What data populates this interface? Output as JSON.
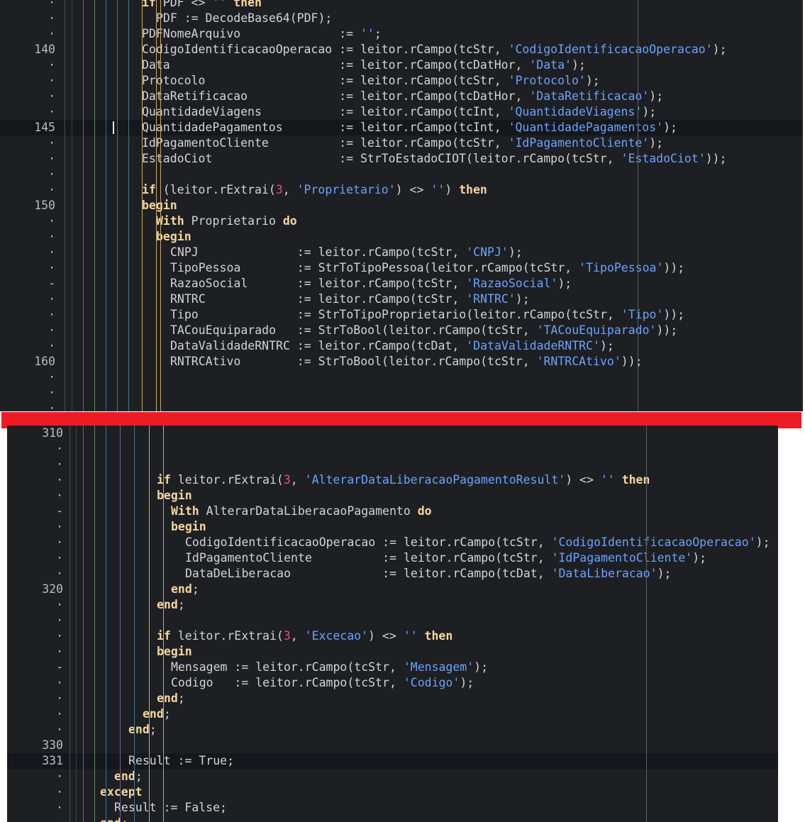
{
  "top_pane": {
    "lines": [
      {
        "gutter": "·",
        "code": [
          [
            "kw",
            "if"
          ],
          [
            "t",
            " PDF <> "
          ],
          [
            "str",
            "''"
          ],
          [
            "t",
            " "
          ],
          [
            "kw",
            "then"
          ]
        ],
        "indent": 0
      },
      {
        "gutter": "·",
        "code": [
          [
            "t",
            "PDF := DecodeBase64(PDF);"
          ]
        ],
        "indent": 1
      },
      {
        "gutter": "·",
        "code": [
          [
            "t",
            "PDFNomeArquivo              := "
          ],
          [
            "str",
            "''"
          ],
          [
            "t",
            ";"
          ]
        ],
        "indent": 0
      },
      {
        "gutter": "140",
        "code": [
          [
            "t",
            "CodigoIdentificacaoOperacao := leitor.rCampo(tcStr, "
          ],
          [
            "str",
            "'CodigoIdentificacaoOperacao'"
          ],
          [
            "t",
            ");"
          ]
        ],
        "indent": 0
      },
      {
        "gutter": "·",
        "code": [
          [
            "t",
            "Data                        := leitor.rCampo(tcDatHor, "
          ],
          [
            "str",
            "'Data'"
          ],
          [
            "t",
            ");"
          ]
        ],
        "indent": 0
      },
      {
        "gutter": "·",
        "code": [
          [
            "t",
            "Protocolo                   := leitor.rCampo(tcStr, "
          ],
          [
            "str",
            "'Protocolo'"
          ],
          [
            "t",
            ");"
          ]
        ],
        "indent": 0
      },
      {
        "gutter": "·",
        "code": [
          [
            "t",
            "DataRetificacao             := leitor.rCampo(tcDatHor, "
          ],
          [
            "str",
            "'DataRetificacao'"
          ],
          [
            "t",
            ");"
          ]
        ],
        "indent": 0
      },
      {
        "gutter": "·",
        "code": [
          [
            "t",
            "QuantidadeViagens           := leitor.rCampo(tcInt, "
          ],
          [
            "str",
            "'QuantidadeViagens'"
          ],
          [
            "t",
            ");"
          ]
        ],
        "indent": 0
      },
      {
        "gutter": "145",
        "current": true,
        "code": [
          [
            "t",
            "QuantidadePagamentos        := leitor.rCampo(tcInt, "
          ],
          [
            "str",
            "'QuantidadePagamentos'"
          ],
          [
            "t",
            ");"
          ]
        ],
        "indent": 0
      },
      {
        "gutter": "·",
        "code": [
          [
            "t",
            "IdPagamentoCliente          := leitor.rCampo(tcStr, "
          ],
          [
            "str",
            "'IdPagamentoCliente'"
          ],
          [
            "t",
            ");"
          ]
        ],
        "indent": 0
      },
      {
        "gutter": "·",
        "code": [
          [
            "t",
            "EstadoCiot                  := StrToEstadoCIOT(leitor.rCampo(tcStr, "
          ],
          [
            "str",
            "'EstadoCiot'"
          ],
          [
            "t",
            "));"
          ]
        ],
        "indent": 0
      },
      {
        "gutter": "·",
        "code": [],
        "indent": 0
      },
      {
        "gutter": "·",
        "code": [
          [
            "kw",
            "if"
          ],
          [
            "t",
            " (leitor.rExtrai("
          ],
          [
            "num",
            "3"
          ],
          [
            "t",
            ", "
          ],
          [
            "str",
            "'Proprietario'"
          ],
          [
            "t",
            ") <> "
          ],
          [
            "str",
            "''"
          ],
          [
            "t",
            ") "
          ],
          [
            "kw",
            "then"
          ]
        ],
        "indent": 0
      },
      {
        "gutter": "150",
        "code": [
          [
            "kw",
            "begin"
          ]
        ],
        "indent": 0
      },
      {
        "gutter": "·",
        "code": [
          [
            "kw",
            "With"
          ],
          [
            "t",
            " Proprietario "
          ],
          [
            "kw",
            "do"
          ]
        ],
        "indent": 1
      },
      {
        "gutter": "·",
        "code": [
          [
            "kw",
            "begin"
          ]
        ],
        "indent": 1
      },
      {
        "gutter": "·",
        "code": [
          [
            "t",
            "CNPJ              := leitor.rCampo(tcStr, "
          ],
          [
            "str",
            "'CNPJ'"
          ],
          [
            "t",
            ");"
          ]
        ],
        "indent": 2
      },
      {
        "gutter": "·",
        "code": [
          [
            "t",
            "TipoPessoa        := StrToTipoPessoa(leitor.rCampo(tcStr, "
          ],
          [
            "str",
            "'TipoPessoa'"
          ],
          [
            "t",
            "));"
          ]
        ],
        "indent": 2
      },
      {
        "gutter": "-",
        "code": [
          [
            "t",
            "RazaoSocial       := leitor.rCampo(tcStr, "
          ],
          [
            "str",
            "'RazaoSocial'"
          ],
          [
            "t",
            ");"
          ]
        ],
        "indent": 2
      },
      {
        "gutter": "·",
        "code": [
          [
            "t",
            "RNTRC             := leitor.rCampo(tcStr, "
          ],
          [
            "str",
            "'RNTRC'"
          ],
          [
            "t",
            ");"
          ]
        ],
        "indent": 2
      },
      {
        "gutter": "·",
        "code": [
          [
            "t",
            "Tipo              := StrToTipoProprietario(leitor.rCampo(tcStr, "
          ],
          [
            "str",
            "'Tipo'"
          ],
          [
            "t",
            "));"
          ]
        ],
        "indent": 2
      },
      {
        "gutter": "·",
        "code": [
          [
            "t",
            "TACouEquiparado   := StrToBool(leitor.rCampo(tcStr, "
          ],
          [
            "str",
            "'TACouEquiparado'"
          ],
          [
            "t",
            "));"
          ]
        ],
        "indent": 2
      },
      {
        "gutter": "·",
        "code": [
          [
            "t",
            "DataValidadeRNTRC := leitor.rCampo(tcDat, "
          ],
          [
            "str",
            "'DataValidadeRNTRC'"
          ],
          [
            "t",
            ");"
          ]
        ],
        "indent": 2
      },
      {
        "gutter": "160",
        "code": [
          [
            "t",
            "RNTRCAtivo        := StrToBool(leitor.rCampo(tcStr, "
          ],
          [
            "str",
            "'RNTRCAtivo'"
          ],
          [
            "t",
            "));"
          ]
        ],
        "indent": 2
      },
      {
        "gutter": "·",
        "code": [],
        "indent": 0
      },
      {
        "gutter": "·",
        "code": [],
        "indent": 0
      },
      {
        "gutter": "·",
        "code": [],
        "indent": 0
      }
    ]
  },
  "bottom_pane": {
    "lines": [
      {
        "gutter": "310",
        "code": [],
        "indent": 0
      },
      {
        "gutter": "·",
        "code": [],
        "indent": 0
      },
      {
        "gutter": "·",
        "code": [],
        "indent": 0
      },
      {
        "gutter": "·",
        "code": [
          [
            "kw",
            "if"
          ],
          [
            "t",
            " leitor.rExtrai("
          ],
          [
            "num",
            "3"
          ],
          [
            "t",
            ", "
          ],
          [
            "str",
            "'AlterarDataLiberacaoPagamentoResult'"
          ],
          [
            "t",
            ") <> "
          ],
          [
            "str",
            "''"
          ],
          [
            "t",
            " "
          ],
          [
            "kw",
            "then"
          ]
        ],
        "indent": 5
      },
      {
        "gutter": "·",
        "code": [
          [
            "kw",
            "begin"
          ]
        ],
        "indent": 5
      },
      {
        "gutter": "-",
        "code": [
          [
            "kw",
            "With"
          ],
          [
            "t",
            " AlterarDataLiberacaoPagamento "
          ],
          [
            "kw",
            "do"
          ]
        ],
        "indent": 6
      },
      {
        "gutter": "·",
        "code": [
          [
            "kw",
            "begin"
          ]
        ],
        "indent": 6
      },
      {
        "gutter": "·",
        "code": [
          [
            "t",
            "CodigoIdentificacaoOperacao := leitor.rCampo(tcStr, "
          ],
          [
            "str",
            "'CodigoIdentificacaoOperacao'"
          ],
          [
            "t",
            ");"
          ]
        ],
        "indent": 7
      },
      {
        "gutter": "·",
        "code": [
          [
            "t",
            "IdPagamentoCliente          := leitor.rCampo(tcStr, "
          ],
          [
            "str",
            "'IdPagamentoCliente'"
          ],
          [
            "t",
            ");"
          ]
        ],
        "indent": 7
      },
      {
        "gutter": "·",
        "code": [
          [
            "t",
            "DataDeLiberacao             := leitor.rCampo(tcDat, "
          ],
          [
            "str",
            "'DataLiberacao'"
          ],
          [
            "t",
            ");"
          ]
        ],
        "indent": 7
      },
      {
        "gutter": "320",
        "code": [
          [
            "kw",
            "end"
          ],
          [
            "t",
            ";"
          ]
        ],
        "indent": 6
      },
      {
        "gutter": "·",
        "code": [
          [
            "kw",
            "end"
          ],
          [
            "t",
            ";"
          ]
        ],
        "indent": 5
      },
      {
        "gutter": "·",
        "code": [],
        "indent": 0
      },
      {
        "gutter": "·",
        "code": [
          [
            "kw",
            "if"
          ],
          [
            "t",
            " leitor.rExtrai("
          ],
          [
            "num",
            "3"
          ],
          [
            "t",
            ", "
          ],
          [
            "str",
            "'Excecao'"
          ],
          [
            "t",
            ") <> "
          ],
          [
            "str",
            "''"
          ],
          [
            "t",
            " "
          ],
          [
            "kw",
            "then"
          ]
        ],
        "indent": 5
      },
      {
        "gutter": "·",
        "code": [
          [
            "kw",
            "begin"
          ]
        ],
        "indent": 5
      },
      {
        "gutter": "-",
        "code": [
          [
            "t",
            "Mensagem := leitor.rCampo(tcStr, "
          ],
          [
            "str",
            "'Mensagem'"
          ],
          [
            "t",
            ");"
          ]
        ],
        "indent": 6
      },
      {
        "gutter": "·",
        "code": [
          [
            "t",
            "Codigo   := leitor.rCampo(tcStr, "
          ],
          [
            "str",
            "'Codigo'"
          ],
          [
            "t",
            ");"
          ]
        ],
        "indent": 6
      },
      {
        "gutter": "·",
        "code": [
          [
            "kw",
            "end"
          ],
          [
            "t",
            ";"
          ]
        ],
        "indent": 5
      },
      {
        "gutter": "·",
        "code": [
          [
            "kw",
            "end"
          ],
          [
            "t",
            ";"
          ]
        ],
        "indent": 4
      },
      {
        "gutter": "·",
        "code": [
          [
            "kw",
            "end"
          ],
          [
            "t",
            ";"
          ]
        ],
        "indent": 3
      },
      {
        "gutter": "330",
        "code": [],
        "indent": 0
      },
      {
        "gutter": "331",
        "current": true,
        "code": [
          [
            "t",
            "Result := True;"
          ]
        ],
        "indent": 3
      },
      {
        "gutter": "·",
        "code": [
          [
            "kw",
            "end"
          ],
          [
            "t",
            ";"
          ]
        ],
        "indent": 2
      },
      {
        "gutter": "·",
        "code": [
          [
            "kw",
            "except"
          ]
        ],
        "indent": 1
      },
      {
        "gutter": "·",
        "code": [
          [
            "t",
            "Result := False;"
          ]
        ],
        "indent": 2
      },
      {
        "gutter": "·",
        "code": [
          [
            "kw",
            "end"
          ],
          [
            "t",
            ";"
          ]
        ],
        "indent": 1
      }
    ]
  },
  "colors": {
    "editor_bg": "#1e1f22",
    "current_line_bg": "#14171b",
    "text": "#d4d4d4",
    "keyword": "#f5d6a0",
    "string": "#6aa3ff",
    "number": "#e44b8c",
    "separator": "#ed1c24"
  }
}
